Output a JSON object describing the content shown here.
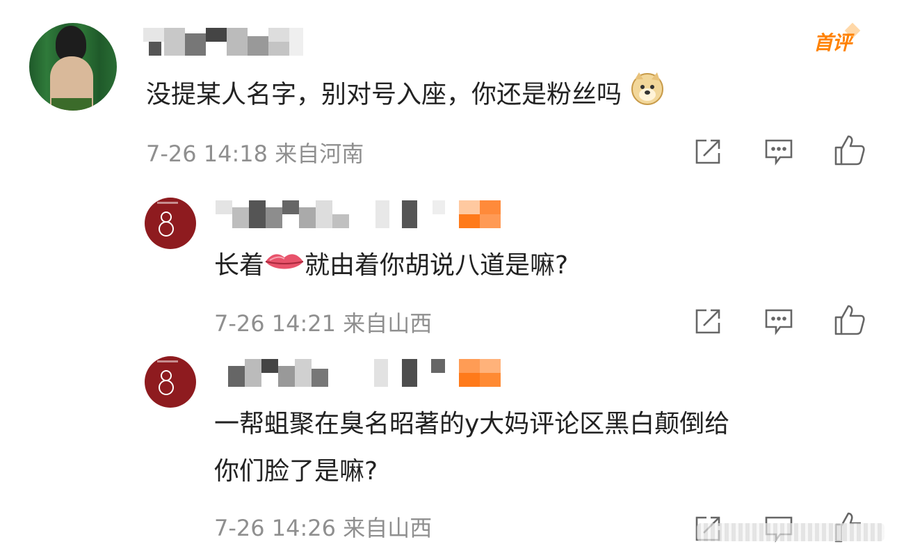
{
  "comments": [
    {
      "text": "没提某人名字，别对号入座，你还是粉丝吗",
      "meta": "7-26 14:18 来自河南",
      "badge": "首评"
    },
    {
      "text": "长着",
      "text_after": "就由着你胡说八道是嘛?",
      "meta": "7-26 14:21 来自山西"
    },
    {
      "line1": "一帮蛆聚在臭名昭著的y大妈评论区黑白颠倒给",
      "line2": "你们脸了是嘛?",
      "meta": "7-26 14:26 来自山西"
    }
  ],
  "icons": {
    "share": "share-icon",
    "comment": "comment-icon",
    "like": "thumbs-up-icon",
    "doge": "doge-emoji-icon",
    "lips": "lips-emoji-icon"
  },
  "colors": {
    "badge": "#ff8200",
    "text": "#222222",
    "meta": "#8f8f8f",
    "icon": "#666666",
    "avatar_red": "#8e1b1f",
    "blur_orange": "#ff7a1a"
  }
}
